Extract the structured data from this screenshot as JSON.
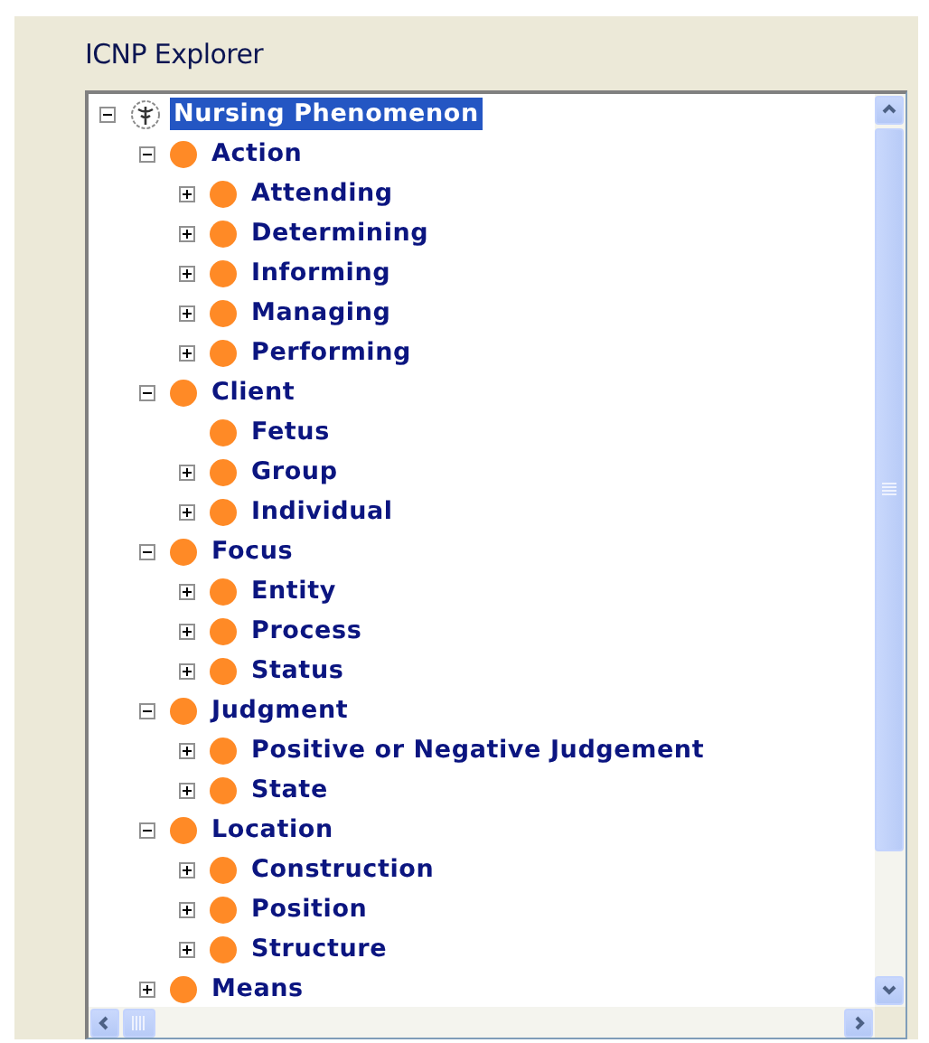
{
  "panel": {
    "title": "ICNP Explorer"
  },
  "tree": [
    {
      "label": "Nursing Phenomenon",
      "kind": "root",
      "expanded": true,
      "selected": true,
      "children": [
        {
          "label": "Action",
          "kind": "folder",
          "expanded": true,
          "selected": false,
          "children": [
            {
              "label": "Attending",
              "kind": "folder",
              "expanded": false,
              "selected": false
            },
            {
              "label": "Determining",
              "kind": "folder",
              "expanded": false,
              "selected": false
            },
            {
              "label": "Informing",
              "kind": "folder",
              "expanded": false,
              "selected": false
            },
            {
              "label": "Managing",
              "kind": "folder",
              "expanded": false,
              "selected": false
            },
            {
              "label": "Performing",
              "kind": "folder",
              "expanded": false,
              "selected": false
            }
          ]
        },
        {
          "label": "Client",
          "kind": "folder",
          "expanded": true,
          "selected": false,
          "children": [
            {
              "label": "Fetus",
              "kind": "leaf",
              "selected": false
            },
            {
              "label": "Group",
              "kind": "folder",
              "expanded": false,
              "selected": false
            },
            {
              "label": "Individual",
              "kind": "folder",
              "expanded": false,
              "selected": false
            }
          ]
        },
        {
          "label": "Focus",
          "kind": "folder",
          "expanded": true,
          "selected": false,
          "children": [
            {
              "label": "Entity",
              "kind": "folder",
              "expanded": false,
              "selected": false
            },
            {
              "label": "Process",
              "kind": "folder",
              "expanded": false,
              "selected": false
            },
            {
              "label": "Status",
              "kind": "folder",
              "expanded": false,
              "selected": false
            }
          ]
        },
        {
          "label": "Judgment",
          "kind": "folder",
          "expanded": true,
          "selected": false,
          "children": [
            {
              "label": "Positive or Negative Judgement",
              "kind": "folder",
              "expanded": false,
              "selected": false
            },
            {
              "label": "State",
              "kind": "folder",
              "expanded": false,
              "selected": false
            }
          ]
        },
        {
          "label": "Location",
          "kind": "folder",
          "expanded": true,
          "selected": false,
          "children": [
            {
              "label": "Construction",
              "kind": "folder",
              "expanded": false,
              "selected": false
            },
            {
              "label": "Position",
              "kind": "folder",
              "expanded": false,
              "selected": false
            },
            {
              "label": "Structure",
              "kind": "folder",
              "expanded": false,
              "selected": false
            }
          ]
        },
        {
          "label": "Means",
          "kind": "folder",
          "expanded": false,
          "selected": false
        }
      ]
    }
  ]
}
